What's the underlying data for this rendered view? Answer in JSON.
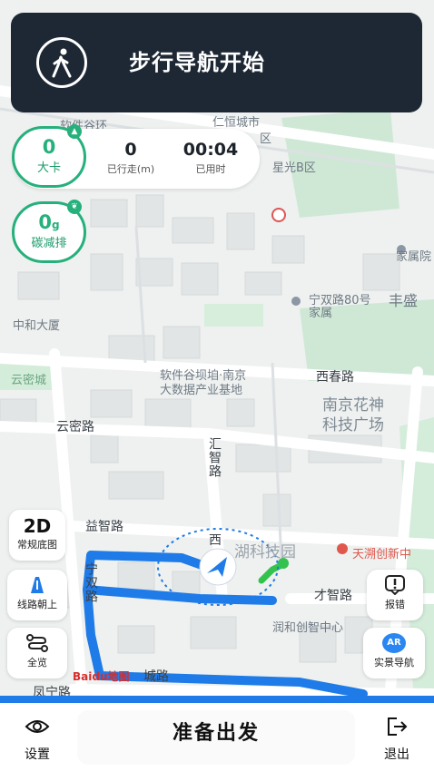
{
  "banner": {
    "title": "步行导航开始",
    "icon": "walking-person-icon"
  },
  "calories": {
    "value": "0",
    "label": "大卡"
  },
  "carbon": {
    "value": "0",
    "unit": "g",
    "label": "碳减排"
  },
  "walked": {
    "value": "0",
    "label": "已行走(m)"
  },
  "elapsed": {
    "value": "00:04",
    "label": "已用时"
  },
  "left_controls": {
    "mode": {
      "value": "2D",
      "label": "常规底图"
    },
    "route_up": {
      "label": "线路朝上",
      "icon": "route-up-icon"
    },
    "overview": {
      "label": "全览",
      "icon": "overview-route-icon"
    }
  },
  "right_controls": {
    "report": {
      "label": "报错",
      "icon": "report-error-icon"
    },
    "ar": {
      "label": "实景导航",
      "badge": "AR"
    }
  },
  "map_labels": {
    "l1": "软件谷环",
    "l2": "仁恒城市",
    "l3": "区",
    "l4": "星光B区",
    "l5": "中和大厦",
    "l6": "宁双路80号",
    "l7": "家属院",
    "l8": "丰盛",
    "l9": "家属",
    "l10": "云密城",
    "l11": "软件谷坝垍·南京",
    "l12": "大数据产业基地",
    "l13": "西春路",
    "l14": "南京花神",
    "l15": "科技广场",
    "l16": "云密路",
    "l17": "益智路",
    "l18": "宁双路",
    "l19": "汇智路",
    "l20": "西",
    "l21": "湖科技园",
    "l22": "天溯创新中",
    "l23": "才智路",
    "l24": "润和创智中心",
    "l25": "城路",
    "l26": "凤宁路",
    "baidu": "Baidu地图"
  },
  "bottom": {
    "settings_label": "设置",
    "start_label": "准备出发",
    "exit_label": "退出"
  },
  "colors": {
    "accent_green": "#25b07c",
    "route_blue": "#1f7be8",
    "banner_bg": "#1e2835"
  }
}
